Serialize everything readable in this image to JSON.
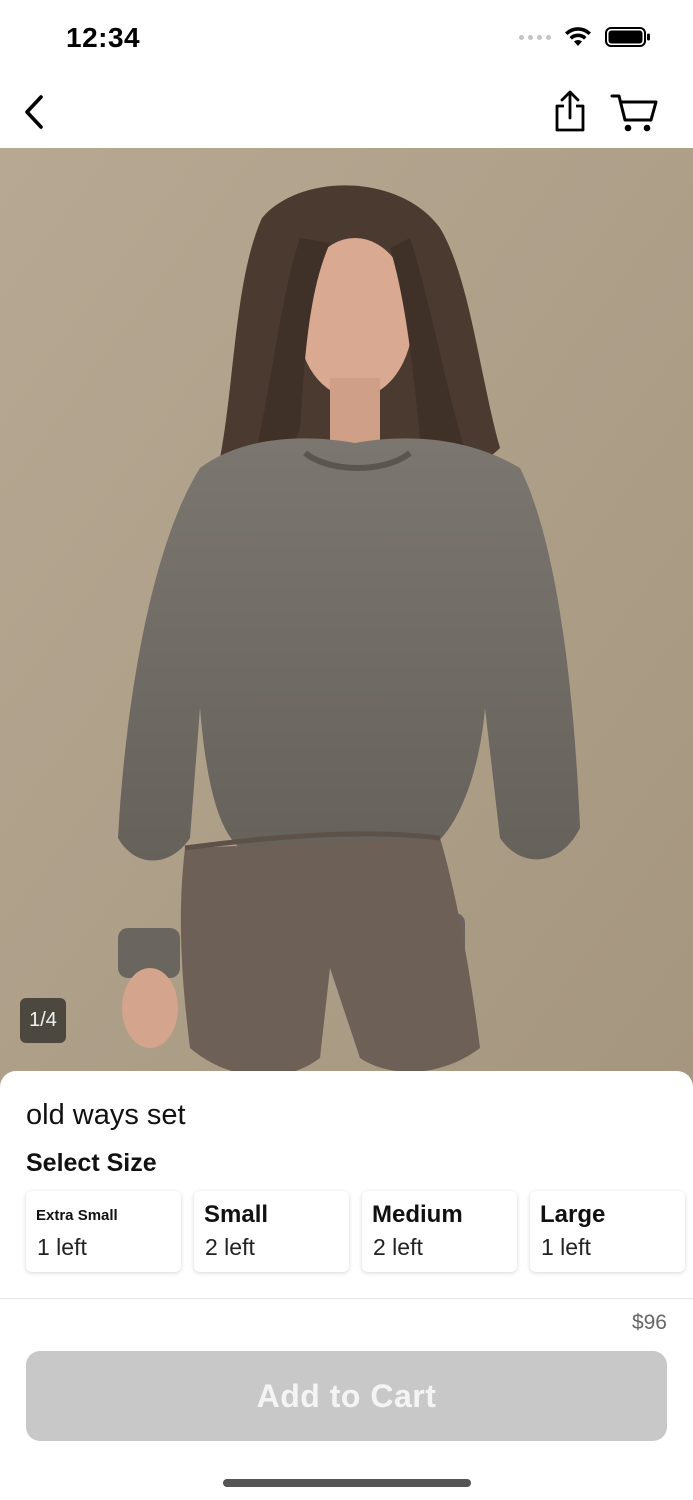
{
  "status_bar": {
    "time": "12:34"
  },
  "nav": {
    "back_icon": "chevron-left-icon",
    "share_icon": "share-icon",
    "cart_icon": "cart-icon"
  },
  "gallery": {
    "page_indicator": "1/4"
  },
  "product": {
    "title": "old ways set",
    "select_size_label": "Select Size",
    "sizes": [
      {
        "name": "Extra Small",
        "stock": "1 left"
      },
      {
        "name": "Small",
        "stock": "2 left"
      },
      {
        "name": "Medium",
        "stock": "2 left"
      },
      {
        "name": "Large",
        "stock": "1 left"
      }
    ],
    "price": "$96",
    "add_to_cart_label": "Add to Cart"
  },
  "colors": {
    "button_disabled": "#c8c8c8",
    "backdrop": "#b1a38e",
    "garment": "#6f6a64"
  }
}
